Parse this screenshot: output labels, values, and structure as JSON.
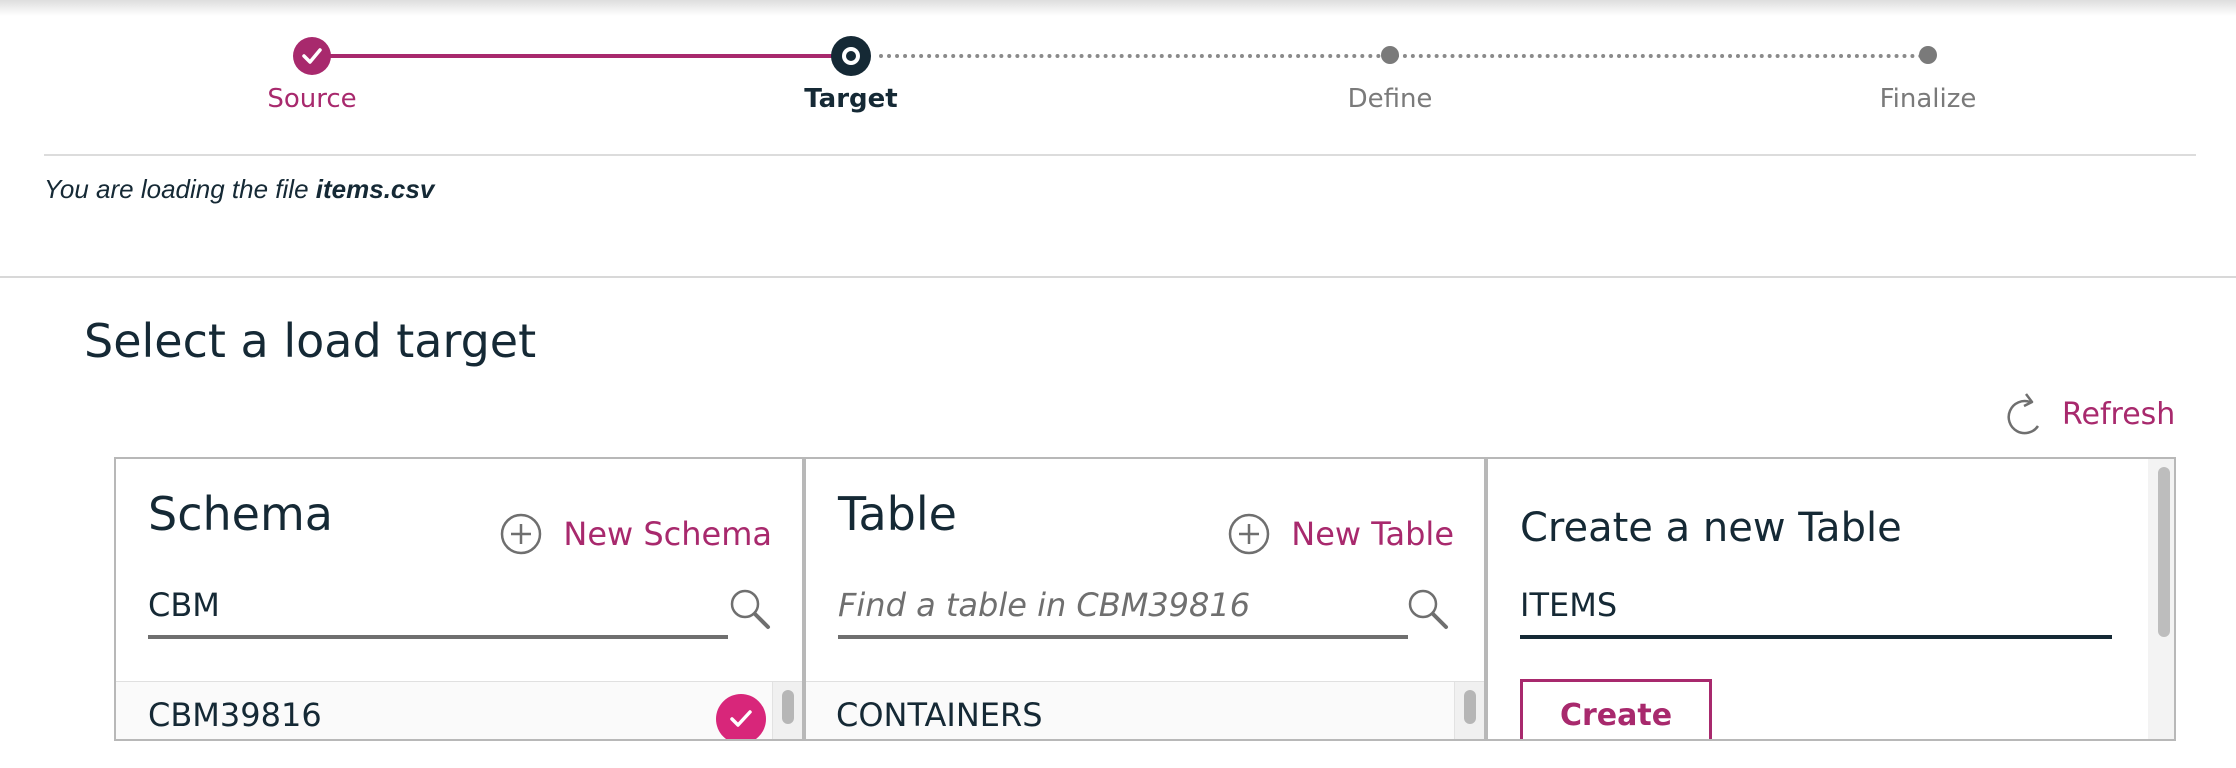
{
  "stepper": {
    "steps": [
      {
        "label": "Source",
        "state": "complete"
      },
      {
        "label": "Target",
        "state": "current"
      },
      {
        "label": "Define",
        "state": "upcoming"
      },
      {
        "label": "Finalize",
        "state": "upcoming"
      }
    ]
  },
  "file_note": {
    "prefix": "You are loading the file",
    "filename": "items.csv"
  },
  "page_title": "Select a load target",
  "refresh_label": "Refresh",
  "schema_panel": {
    "title": "Schema",
    "new_label": "New Schema",
    "search_value": "CBM",
    "items": [
      {
        "label": "CBM39816",
        "selected": true
      }
    ]
  },
  "table_panel": {
    "title": "Table",
    "new_label": "New Table",
    "search_placeholder": "Find a table in CBM39816",
    "items": [
      {
        "label": "CONTAINERS"
      }
    ]
  },
  "create_panel": {
    "title": "Create a new Table",
    "name_value": "ITEMS",
    "create_label": "Create"
  },
  "colors": {
    "accent": "#a8296d",
    "check": "#d8267a",
    "text": "#152935",
    "muted": "#7a7a7a"
  },
  "icons": {
    "step_complete": "checkmark-icon",
    "refresh": "refresh-icon",
    "add": "add-circle-icon",
    "search": "search-icon",
    "selected": "checkmark-circle-icon"
  }
}
